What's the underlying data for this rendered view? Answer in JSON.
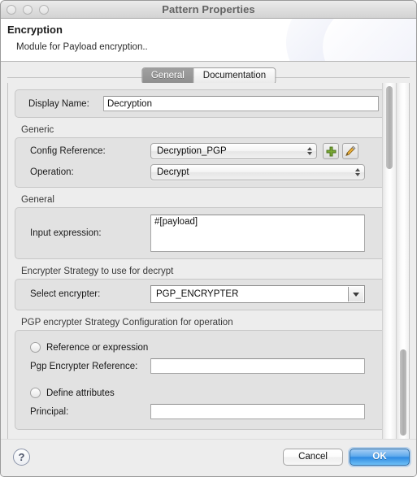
{
  "window": {
    "title": "Pattern Properties",
    "traffic_lights": [
      "close-button",
      "minimize-button",
      "zoom-button"
    ]
  },
  "header": {
    "title": "Encryption",
    "subtitle": "Module for Payload encryption.."
  },
  "tabs": [
    {
      "label": "General",
      "active": true
    },
    {
      "label": "Documentation",
      "active": false
    }
  ],
  "form": {
    "display_name": {
      "label": "Display Name:",
      "value": "Decryption",
      "placeholder": ""
    },
    "generic": {
      "section_label": "Generic",
      "config_reference": {
        "label": "Config Reference:",
        "value": "Decryption_PGP"
      },
      "add_button": "+",
      "edit_button": "pencil",
      "operation": {
        "label": "Operation:",
        "value": "Decrypt"
      }
    },
    "general": {
      "section_label": "General",
      "input_expression": {
        "label": "Input expression:",
        "value": "#[payload]",
        "placeholder": ""
      }
    },
    "encrypter_strategy": {
      "section_label": "Encrypter Strategy to use for decrypt",
      "select_encrypter": {
        "label": "Select encrypter:",
        "value": "PGP_ENCRYPTER"
      }
    },
    "pgp_config": {
      "section_label": "PGP encrypter Strategy Configuration for operation",
      "radio_reference": {
        "label": "Reference or expression",
        "selected": false
      },
      "pgp_encrypter_reference": {
        "label": "Pgp Encrypter Reference:",
        "value": "",
        "placeholder": ""
      },
      "radio_define": {
        "label": "Define attributes",
        "selected": false
      },
      "principal": {
        "label": "Principal:",
        "value": "",
        "placeholder": ""
      }
    }
  },
  "footer": {
    "help_label": "?",
    "cancel_label": "Cancel",
    "ok_label": "OK"
  },
  "colors": {
    "accent": "#2e8ae2",
    "window_bg": "#ededed",
    "group_bg": "#e2e2e2",
    "add_icon": "#6f9e2f",
    "edit_icon": "#e8a12a"
  }
}
